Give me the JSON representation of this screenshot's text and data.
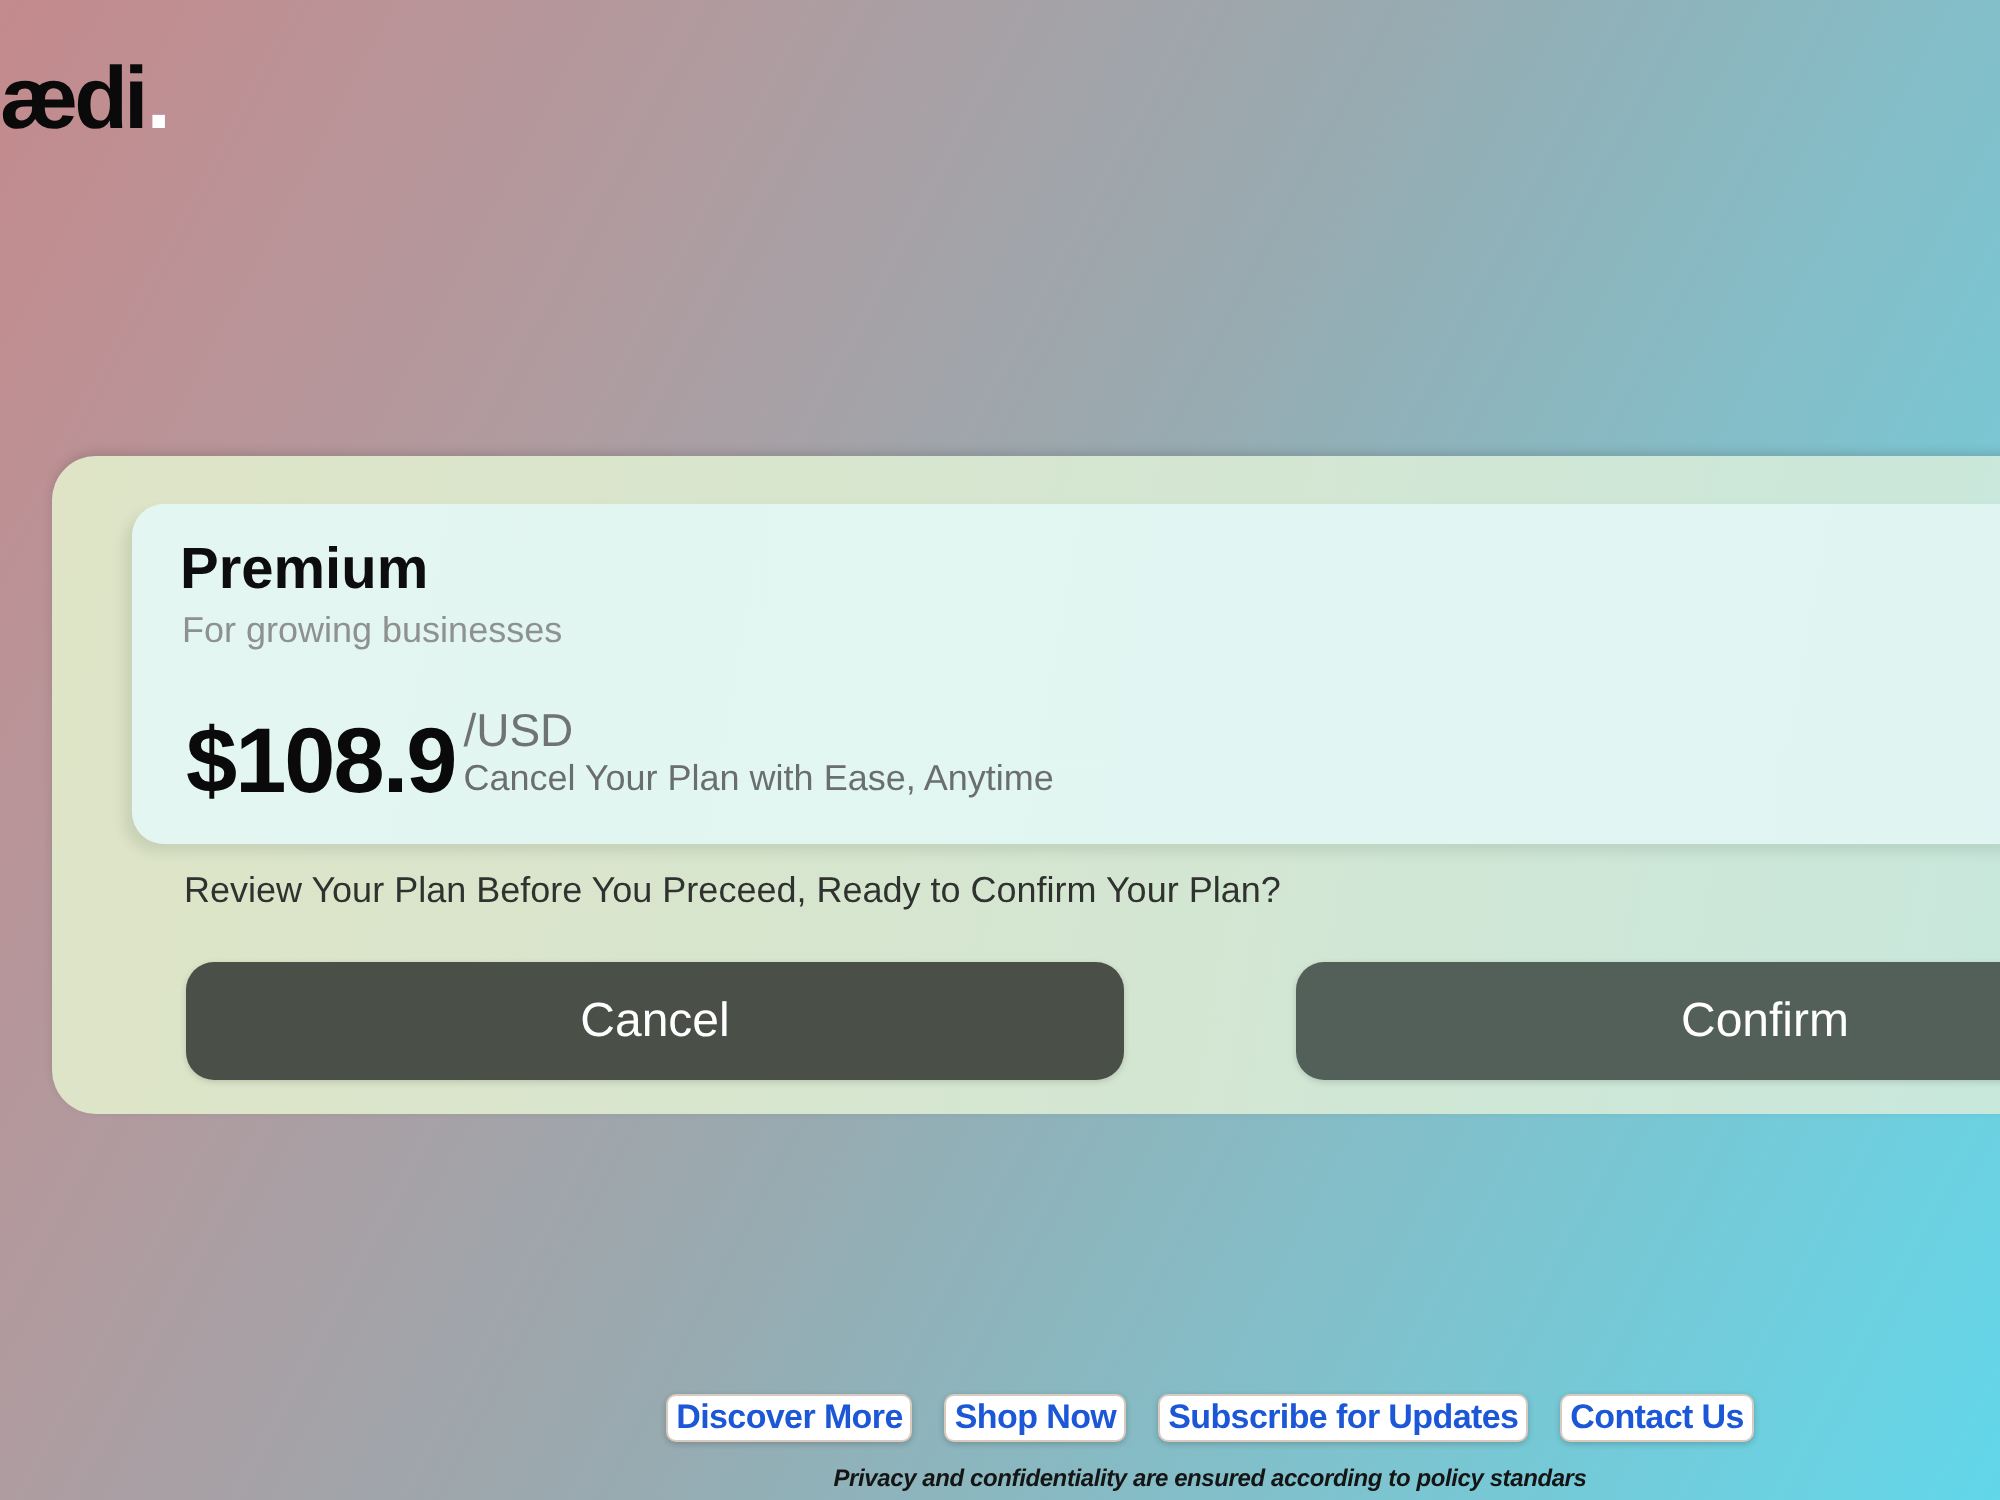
{
  "logo": {
    "text": "ædi",
    "dot": "."
  },
  "plan": {
    "name": "Premium",
    "tagline": "For growing businesses",
    "price": "$108.9",
    "currency": "/USD",
    "note": "Cancel Your Plan with Ease, Anytime"
  },
  "prompt": "Review Your Plan Before You Preceed, Ready to Confirm Your Plan?",
  "actions": [
    {
      "label": "Cancel",
      "kind": "cancel"
    },
    {
      "label": "Confirm",
      "kind": "confirm"
    }
  ],
  "footer": {
    "links": [
      "Discover More",
      "Shop Now",
      "Subscribe for Updates",
      "Contact Us"
    ],
    "notice": "Privacy and confidentiality are ensured according to policy standars"
  }
}
